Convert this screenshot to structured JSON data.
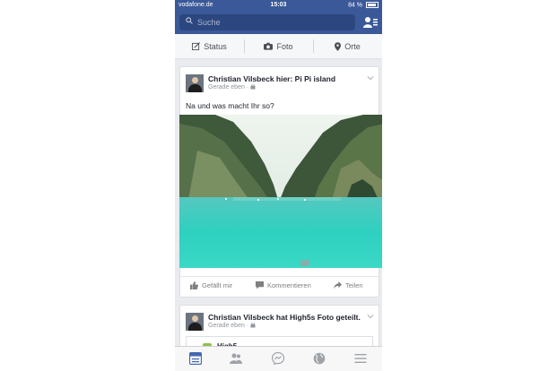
{
  "statusbar": {
    "carrier": "vodafone.de",
    "time": "15:03",
    "battery": "84 %"
  },
  "search": {
    "placeholder": "Suche"
  },
  "composer": {
    "status": "Status",
    "photo": "Foto",
    "places": "Orte"
  },
  "posts": [
    {
      "author": "Christian Vilsbeck hier: Pi Pi island",
      "time": "Gerade eben · ",
      "text": "Na und was macht Ihr so?",
      "actions": {
        "like": "Gefällt mir",
        "comment": "Kommentieren",
        "share": "Teilen"
      }
    },
    {
      "author": "Christian Vilsbeck hat High5s Foto geteilt.",
      "time": "Gerade eben · ",
      "shared_title": "High5"
    }
  ],
  "tabs": [
    "news-feed-icon",
    "friends-icon",
    "messenger-icon",
    "globe-icon",
    "menu-icon"
  ],
  "colors": {
    "brand": "#3b5998",
    "active_tab": "#4267b2"
  }
}
